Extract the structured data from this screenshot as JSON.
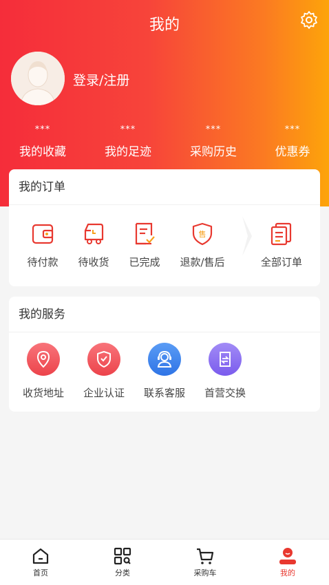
{
  "header": {
    "title": "我的"
  },
  "profile": {
    "login_label": "登录/注册"
  },
  "stats": [
    {
      "value": "***",
      "label": "我的收藏"
    },
    {
      "value": "***",
      "label": "我的足迹"
    },
    {
      "value": "***",
      "label": "采购历史"
    },
    {
      "value": "***",
      "label": "优惠券"
    }
  ],
  "orders": {
    "title": "我的订单",
    "items": [
      {
        "label": "待付款",
        "icon": "wallet-icon"
      },
      {
        "label": "待收货",
        "icon": "truck-icon"
      },
      {
        "label": "已完成",
        "icon": "completed-doc-icon"
      },
      {
        "label": "退款/售后",
        "icon": "after-sales-shield-icon"
      },
      {
        "label": "全部订单",
        "icon": "all-orders-icon"
      }
    ]
  },
  "services": {
    "title": "我的服务",
    "items": [
      {
        "label": "收货地址",
        "icon": "location-pin-icon",
        "color": "#f0555c"
      },
      {
        "label": "企业认证",
        "icon": "shield-check-icon",
        "color": "#f0555c"
      },
      {
        "label": "联系客服",
        "icon": "customer-service-icon",
        "color": "#3a86f0"
      },
      {
        "label": "首营交换",
        "icon": "exchange-doc-icon",
        "color": "#8a6cf0"
      }
    ]
  },
  "tabbar": {
    "items": [
      {
        "label": "首页",
        "icon": "home-icon"
      },
      {
        "label": "分类",
        "icon": "category-icon"
      },
      {
        "label": "采购车",
        "icon": "cart-icon"
      },
      {
        "label": "我的",
        "icon": "profile-icon",
        "active": true
      }
    ],
    "active_color": "#e8382f"
  },
  "colors": {
    "accent": "#f52d3a",
    "gradient_end": "#fda40a"
  }
}
